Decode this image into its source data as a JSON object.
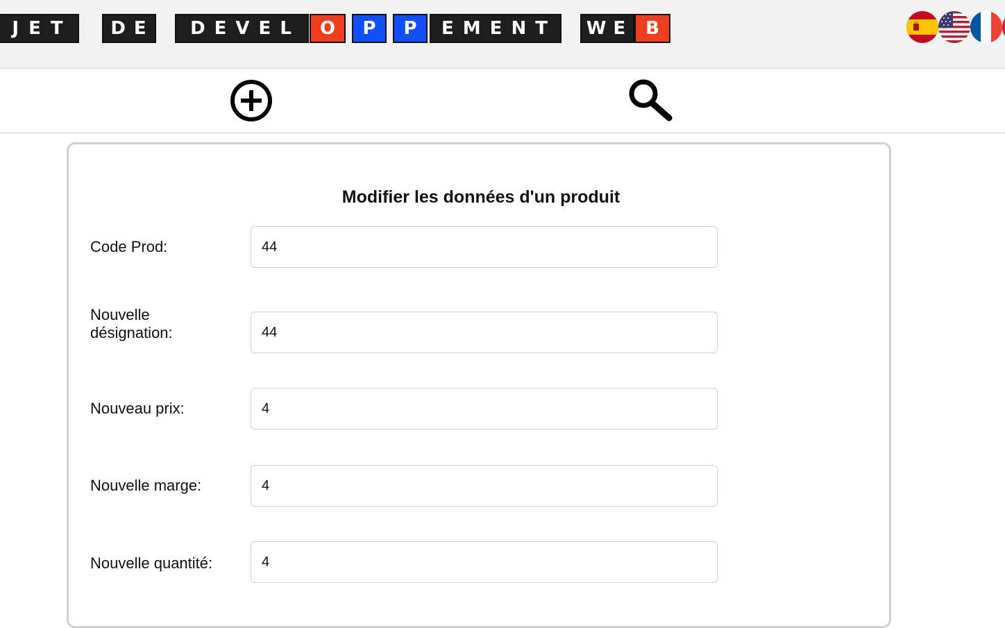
{
  "header": {
    "title_tiles": [
      {
        "text": "JET",
        "style": "split"
      },
      {
        "text": "DE",
        "style": "split"
      },
      {
        "text": "DEVEL",
        "style": "split"
      },
      {
        "text": "O",
        "style": "red"
      },
      {
        "text": "P",
        "style": "blue"
      },
      {
        "text": "P",
        "style": "blue"
      },
      {
        "text": "EMENT",
        "style": "split"
      },
      {
        "text": "WE",
        "style": "split"
      },
      {
        "text": "B",
        "style": "red"
      }
    ],
    "languages": [
      {
        "name": "spanish-flag-icon"
      },
      {
        "name": "us-flag-icon"
      },
      {
        "name": "french-flag-icon"
      },
      {
        "name": "moroccan-flag-icon"
      }
    ]
  },
  "toolbar": {
    "add_icon": "add-circle-icon",
    "search_icon": "search-icon"
  },
  "form": {
    "title": "Modifier les données d'un produit",
    "fields": [
      {
        "label": "Code Prod:",
        "value": "44"
      },
      {
        "label": "Nouvelle désignation:",
        "value": "44"
      },
      {
        "label": "Nouveau prix:",
        "value": "4"
      },
      {
        "label": "Nouvelle marge:",
        "value": "4"
      },
      {
        "label": "Nouvelle quantité:",
        "value": "4"
      }
    ]
  },
  "colors": {
    "banner_bg": "#f2f2f2",
    "tile_dark": "#1e1e1e",
    "tile_red": "#f03c1f",
    "tile_blue": "#0f4fff",
    "card_border": "#d0d0d0"
  }
}
